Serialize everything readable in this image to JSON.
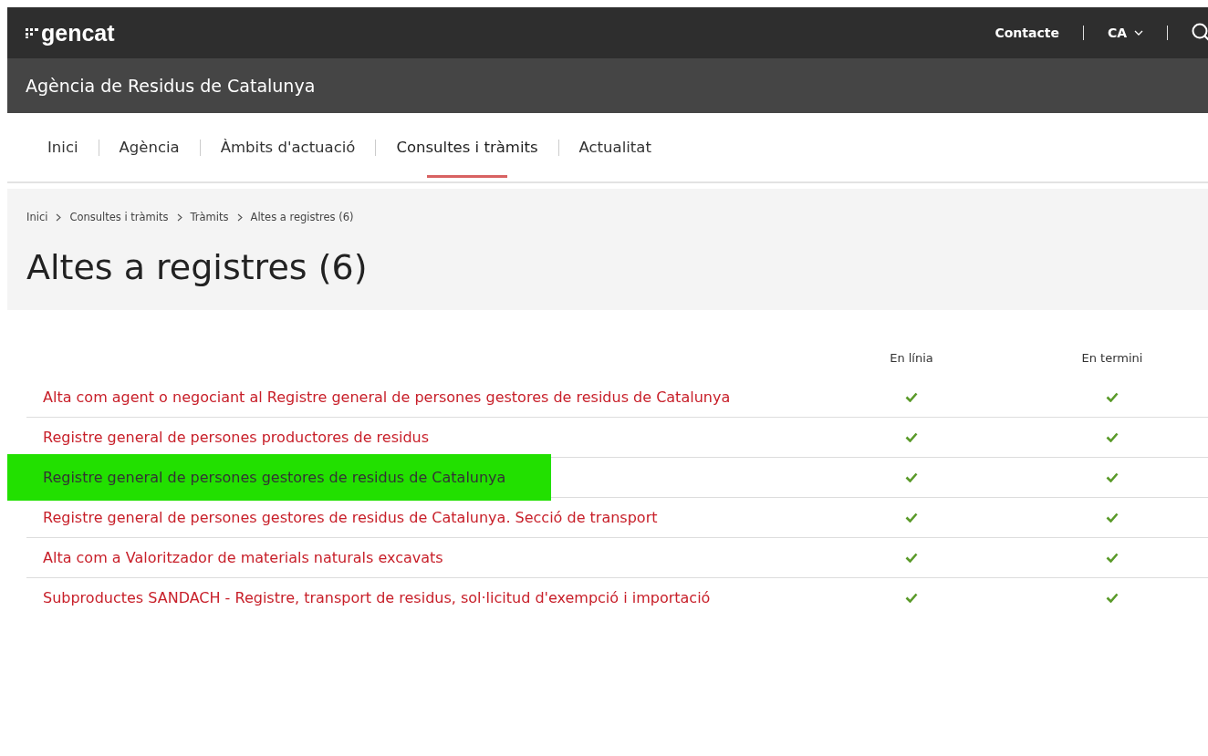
{
  "header": {
    "logo": "gencat",
    "links": [
      "Contacte",
      "CA"
    ],
    "agency": "Agència de Residus de Catalunya"
  },
  "nav": [
    {
      "label": "Inici",
      "selected": false
    },
    {
      "label": "Agència",
      "selected": false
    },
    {
      "label": "Àmbits d'actuació",
      "selected": false
    },
    {
      "label": "Consultes i tràmits",
      "selected": true
    },
    {
      "label": "Actualitat",
      "selected": false
    }
  ],
  "breadcrumb": [
    "Inici",
    "Consultes i tràmits",
    "Tràmits",
    "Altes a registres (6)"
  ],
  "title": "Altes a registres (6)",
  "table": {
    "columns": [
      "En línia",
      "En termini"
    ],
    "rows": [
      {
        "label": "Alta com agent o negociant al Registre general de persones gestores de residus de Catalunya",
        "online": true,
        "deadline": true,
        "highlighted": false
      },
      {
        "label": "Registre general de persones productores de residus",
        "online": true,
        "deadline": true,
        "highlighted": false
      },
      {
        "label": "Registre general de persones gestores de residus de Catalunya",
        "online": true,
        "deadline": true,
        "highlighted": true
      },
      {
        "label": "Registre general de persones gestores de residus de Catalunya. Secció de transport",
        "online": true,
        "deadline": true,
        "highlighted": false
      },
      {
        "label": "Alta com a Valoritzador de materials naturals excavats",
        "online": true,
        "deadline": true,
        "highlighted": false
      },
      {
        "label": "Subproductes SANDACH - Registre, transport de residus, sol·licitud d'exempció i importació",
        "online": true,
        "deadline": true,
        "highlighted": false
      }
    ]
  }
}
